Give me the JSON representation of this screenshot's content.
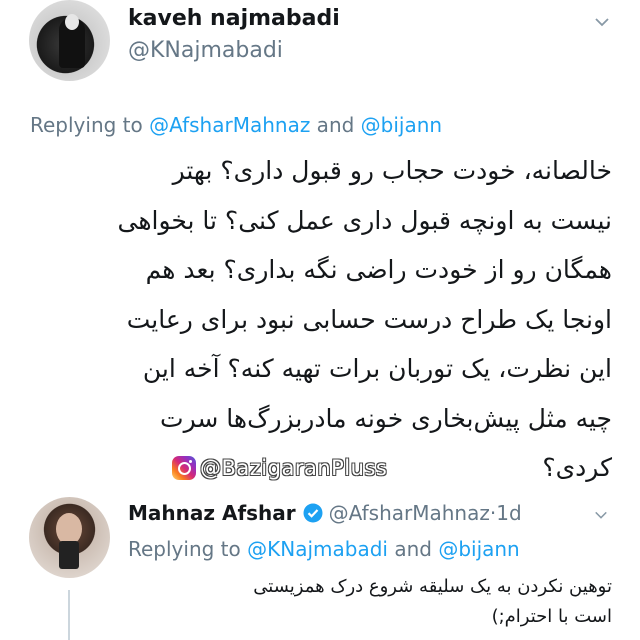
{
  "tweet1": {
    "display_name": "kaveh najmabadi",
    "handle": "@KNajmabadi",
    "reply_prefix": "Replying to ",
    "reply_mention1": "@AfsharMahnaz",
    "reply_and": " and ",
    "reply_mention2": "@bijann",
    "body_lines": [
      "خالصانه، خودت حجاب رو قبول داری؟ بهتر",
      "نیست به اونچه قبول داری عمل کنی؟ تا بخواهی",
      "همگان رو از خودت راضی نگه بداری؟ بعد هم",
      "اونجا یک طراح درست حسابی نبود برای رعایت",
      "این نظرت، یک توربان برات تهیه کنه؟ آخه این",
      "چیه مثل پیش‌بخاری خونه مادربزرگ‌ها سرت",
      "کردی؟"
    ]
  },
  "watermark": {
    "text": "@BazigaranPluss",
    "icon": "instagram-icon"
  },
  "tweet2": {
    "display_name": "Mahnaz Afshar",
    "handle": "@AfsharMahnaz",
    "separator": " · ",
    "time": "1d",
    "reply_prefix": "Replying to ",
    "reply_mention1": "@KNajmabadi",
    "reply_and": " and ",
    "reply_mention2": "@bijann",
    "body_lines": [
      "توهین نکردن به یک سلیقه شروع درک همزیستی",
      "است با احترام;)"
    ]
  },
  "colors": {
    "link": "#1da1f2",
    "secondary_text": "#657786",
    "primary_text": "#14171a",
    "thread_line": "#ccd6dd"
  }
}
